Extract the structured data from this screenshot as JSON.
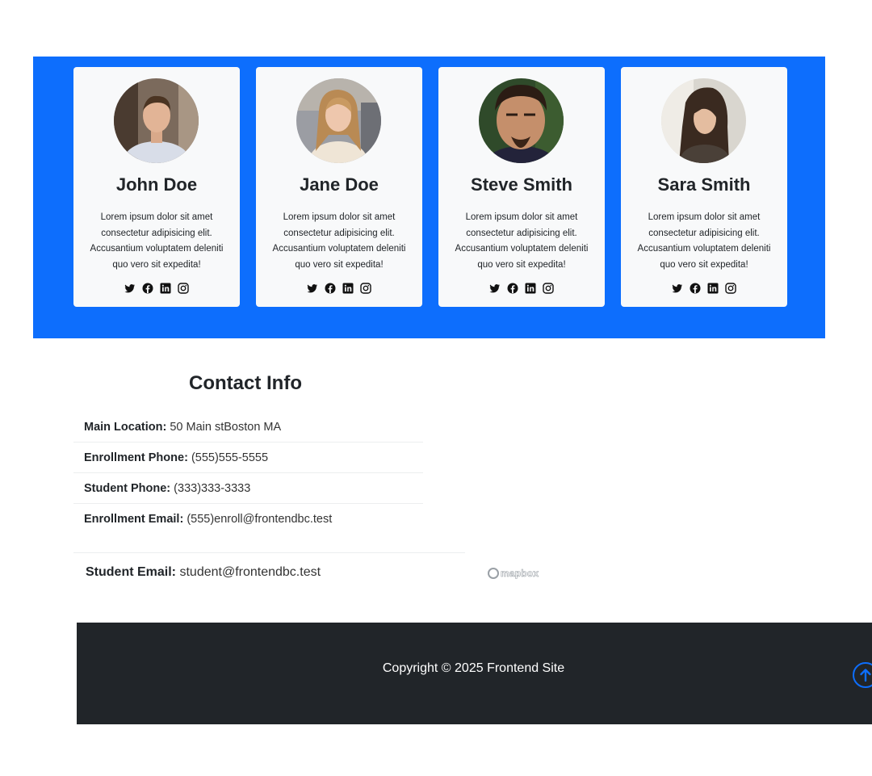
{
  "team": [
    {
      "name": "John Doe",
      "bio": "Lorem ipsum dolor sit amet consectetur adipisicing elit. Accusantium voluptatem deleniti quo vero sit expedita!"
    },
    {
      "name": "Jane Doe",
      "bio": "Lorem ipsum dolor sit amet consectetur adipisicing elit. Accusantium voluptatem deleniti quo vero sit expedita!"
    },
    {
      "name": "Steve Smith",
      "bio": "Lorem ipsum dolor sit amet consectetur adipisicing elit. Accusantium voluptatem deleniti quo vero sit expedita!"
    },
    {
      "name": "Sara Smith",
      "bio": "Lorem ipsum dolor sit amet consectetur adipisicing elit. Accusantium voluptatem deleniti quo vero sit expedita!"
    }
  ],
  "social_icons": [
    "twitter-icon",
    "facebook-icon",
    "linkedin-icon",
    "instagram-icon"
  ],
  "contact": {
    "title": "Contact Info",
    "rows": [
      {
        "label": "Main Location:",
        "value": "50 Main stBoston MA"
      },
      {
        "label": "Enrollment Phone:",
        "value": "(555)555-5555"
      },
      {
        "label": "Student Phone:",
        "value": "(333)333-3333"
      },
      {
        "label": "Enrollment Email:",
        "value": "(555)enroll@frontendbc.test"
      },
      {
        "label": "Student Email:",
        "value": "student@frontendbc.test"
      }
    ],
    "map_attribution": "mapbox"
  },
  "footer": {
    "copyright": "Copyright © 2025 Frontend Site"
  },
  "colors": {
    "primary": "#0d6efd",
    "card": "#f8f9fa",
    "footer": "#212529"
  }
}
